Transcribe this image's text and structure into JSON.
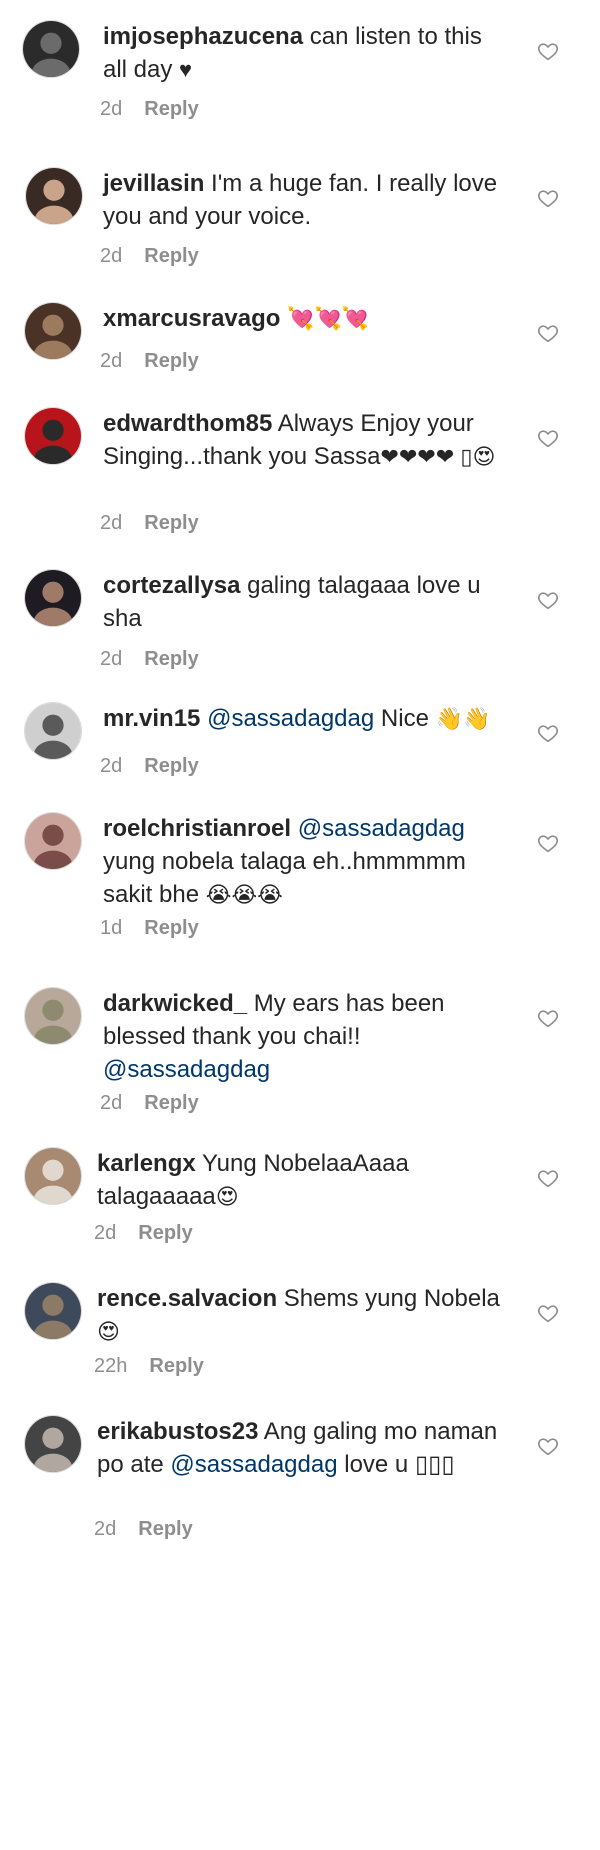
{
  "comments": [
    {
      "username": "imjosephazucena",
      "parts": [
        {
          "t": " can listen to this all day "
        },
        {
          "t": "♥",
          "emoji": true
        }
      ],
      "time": "2d",
      "reply": "Reply"
    },
    {
      "username": "jevillasin",
      "parts": [
        {
          "t": " I'm a huge fan. I really love you and your voice."
        }
      ],
      "time": "2d",
      "reply": "Reply"
    },
    {
      "username": "xmarcusravago",
      "parts": [
        {
          "t": " "
        },
        {
          "t": "💘💘💘",
          "emoji": true
        }
      ],
      "time": "2d",
      "reply": "Reply"
    },
    {
      "username": "edwardthom85",
      "parts": [
        {
          "t": " Always Enjoy your Singing...thank you Sassa"
        },
        {
          "t": "❤❤❤❤ ▯😍",
          "emoji": true
        }
      ],
      "time": "2d",
      "reply": "Reply"
    },
    {
      "username": "cortezallysa",
      "parts": [
        {
          "t": " galing talagaaa love u sha"
        }
      ],
      "time": "2d",
      "reply": "Reply"
    },
    {
      "username": "mr.vin15",
      "parts": [
        {
          "t": " "
        },
        {
          "t": "@sassadagdag",
          "mention": true
        },
        {
          "t": " Nice "
        },
        {
          "t": "👋👋",
          "emoji": true
        }
      ],
      "time": "2d",
      "reply": "Reply"
    },
    {
      "username": "roelchristianroel",
      "parts": [
        {
          "t": " "
        },
        {
          "t": "@sassadagdag",
          "mention": true
        },
        {
          "t": " yung nobela talaga eh..hmmmmm sakit bhe "
        },
        {
          "t": "😭😭😭",
          "emoji": true
        }
      ],
      "time": "1d",
      "reply": "Reply"
    },
    {
      "username": "darkwicked_",
      "parts": [
        {
          "t": " My ears has been blessed thank you chai!! "
        },
        {
          "t": "@sassadagdag",
          "mention": true
        }
      ],
      "time": "2d",
      "reply": "Reply"
    },
    {
      "username": "karlengx",
      "parts": [
        {
          "t": " Yung NobelaaAaaa talagaaaaa"
        },
        {
          "t": "😍",
          "emoji": true
        }
      ],
      "time": "2d",
      "reply": "Reply"
    },
    {
      "username": "rence.salvacion",
      "parts": [
        {
          "t": " Shems yung Nobela "
        },
        {
          "t": "😍",
          "emoji": true
        }
      ],
      "time": "22h",
      "reply": "Reply"
    },
    {
      "username": "erikabustos23",
      "parts": [
        {
          "t": " Ang galing mo naman po ate "
        },
        {
          "t": "@sassadagdag",
          "mention": true
        },
        {
          "t": " love u ▯▯▯"
        }
      ],
      "time": "2d",
      "reply": "Reply"
    }
  ],
  "icons": {
    "like": "heart-outline-icon",
    "avatar": "profile-photo"
  },
  "colors": {
    "username": "#262626",
    "mention": "#00376b",
    "meta": "#8e8e8e",
    "border": "#dbdbdb"
  }
}
